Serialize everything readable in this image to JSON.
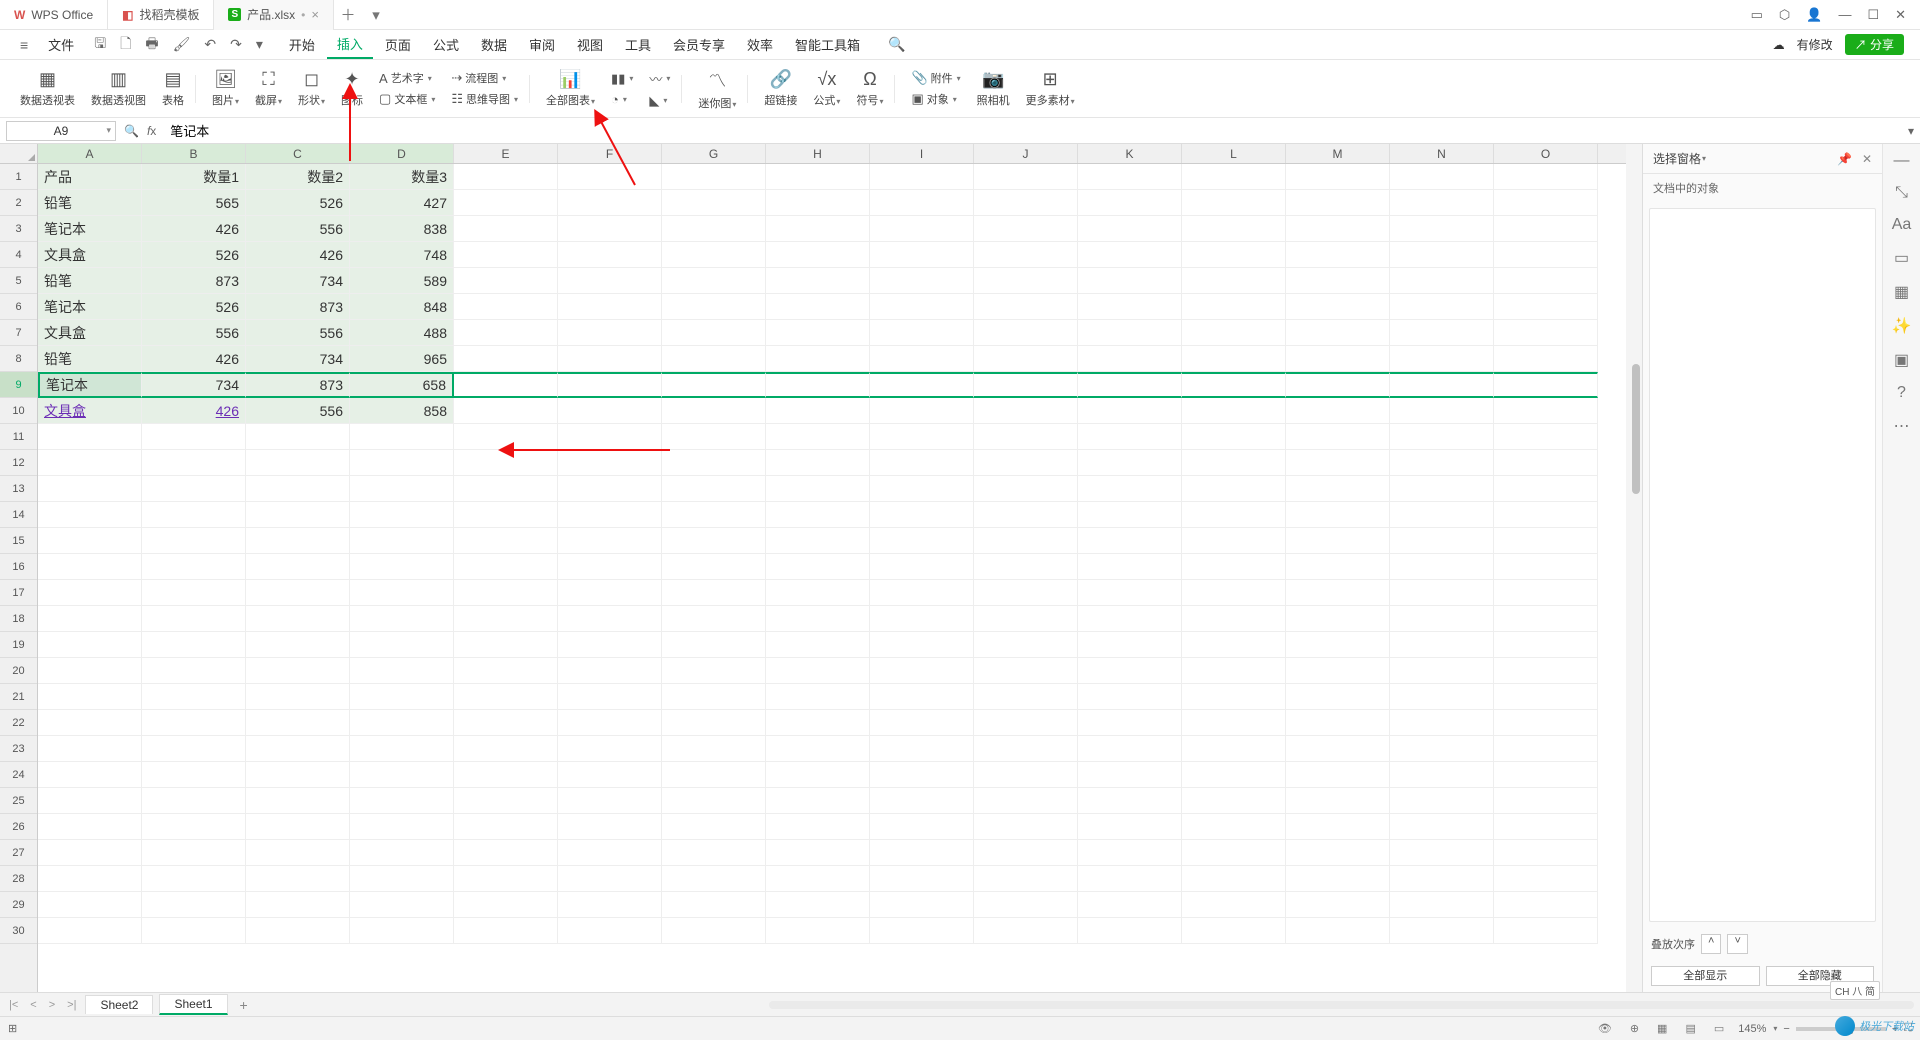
{
  "tabs": {
    "t1": "WPS Office",
    "t2": "找稻壳模板",
    "t3": "产品.xlsx"
  },
  "menu": {
    "file": "文件",
    "start": "开始",
    "insert": "插入",
    "page": "页面",
    "formula": "公式",
    "data": "数据",
    "review": "审阅",
    "view": "视图",
    "tool": "工具",
    "member": "会员专享",
    "effic": "效率",
    "smart": "智能工具箱",
    "hasChange": "有修改",
    "share": "分享"
  },
  "ribbon": {
    "pivot": "数据透视表",
    "pivotChart": "数据透视图",
    "table": "表格",
    "pic": "图片",
    "screenshot": "截屏",
    "shape": "形状",
    "icon": "图标",
    "art": "艺术字",
    "textbox": "文本框",
    "flow": "流程图",
    "mindmap": "思维导图",
    "allChart": "全部图表",
    "spark": "迷你图",
    "link": "超链接",
    "formula": "公式",
    "symbol": "符号",
    "attach": "附件",
    "obj": "对象",
    "camera": "照相机",
    "more": "更多素材"
  },
  "namebox": "A9",
  "formula": "笔记本",
  "cols": [
    "A",
    "B",
    "C",
    "D",
    "E",
    "F",
    "G",
    "H",
    "I",
    "J",
    "K",
    "L",
    "M",
    "N",
    "O"
  ],
  "headers": {
    "c0": "产品",
    "c1": "数量1",
    "c2": "数量2",
    "c3": "数量3"
  },
  "rows": [
    {
      "p": "铅笔",
      "a": "565",
      "b": "526",
      "c": "427"
    },
    {
      "p": "笔记本",
      "a": "426",
      "b": "556",
      "c": "838"
    },
    {
      "p": "文具盒",
      "a": "526",
      "b": "426",
      "c": "748"
    },
    {
      "p": "铅笔",
      "a": "873",
      "b": "734",
      "c": "589"
    },
    {
      "p": "笔记本",
      "a": "526",
      "b": "873",
      "c": "848"
    },
    {
      "p": "文具盒",
      "a": "556",
      "b": "556",
      "c": "488"
    },
    {
      "p": "铅笔",
      "a": "426",
      "b": "734",
      "c": "965"
    },
    {
      "p": "笔记本",
      "a": "734",
      "b": "873",
      "c": "658"
    },
    {
      "p": "文具盒",
      "a": "426",
      "b": "556",
      "c": "858"
    }
  ],
  "rpane": {
    "title": "选择窗格",
    "objLabel": "文档中的对象",
    "stack": "叠放次序",
    "showAll": "全部显示",
    "hideAll": "全部隐藏"
  },
  "sheets": {
    "s1": "Sheet2",
    "s2": "Sheet1"
  },
  "status": {
    "zoom": "145%"
  },
  "ime": "CH 八 简",
  "watermark": "极光下载站"
}
